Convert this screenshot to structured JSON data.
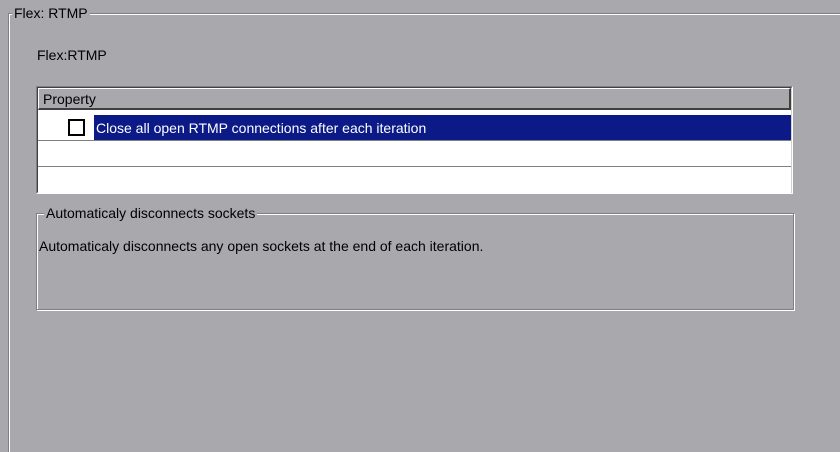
{
  "group": {
    "legend": "Flex: RTMP"
  },
  "section": {
    "title": "Flex:RTMP"
  },
  "grid": {
    "header": "Property",
    "rows": [
      {
        "label": "Close all open RTMP connections after each iteration",
        "checked": false,
        "selected": true
      },
      {
        "label": ""
      },
      {
        "label": ""
      }
    ]
  },
  "description": {
    "title": "Automaticaly disconnects sockets",
    "text": "Automaticaly disconnects any open sockets at the end of each iteration."
  },
  "colors": {
    "background": "#a9a8ad",
    "selection": "#0b1a87",
    "selection_text": "#ffffff"
  }
}
